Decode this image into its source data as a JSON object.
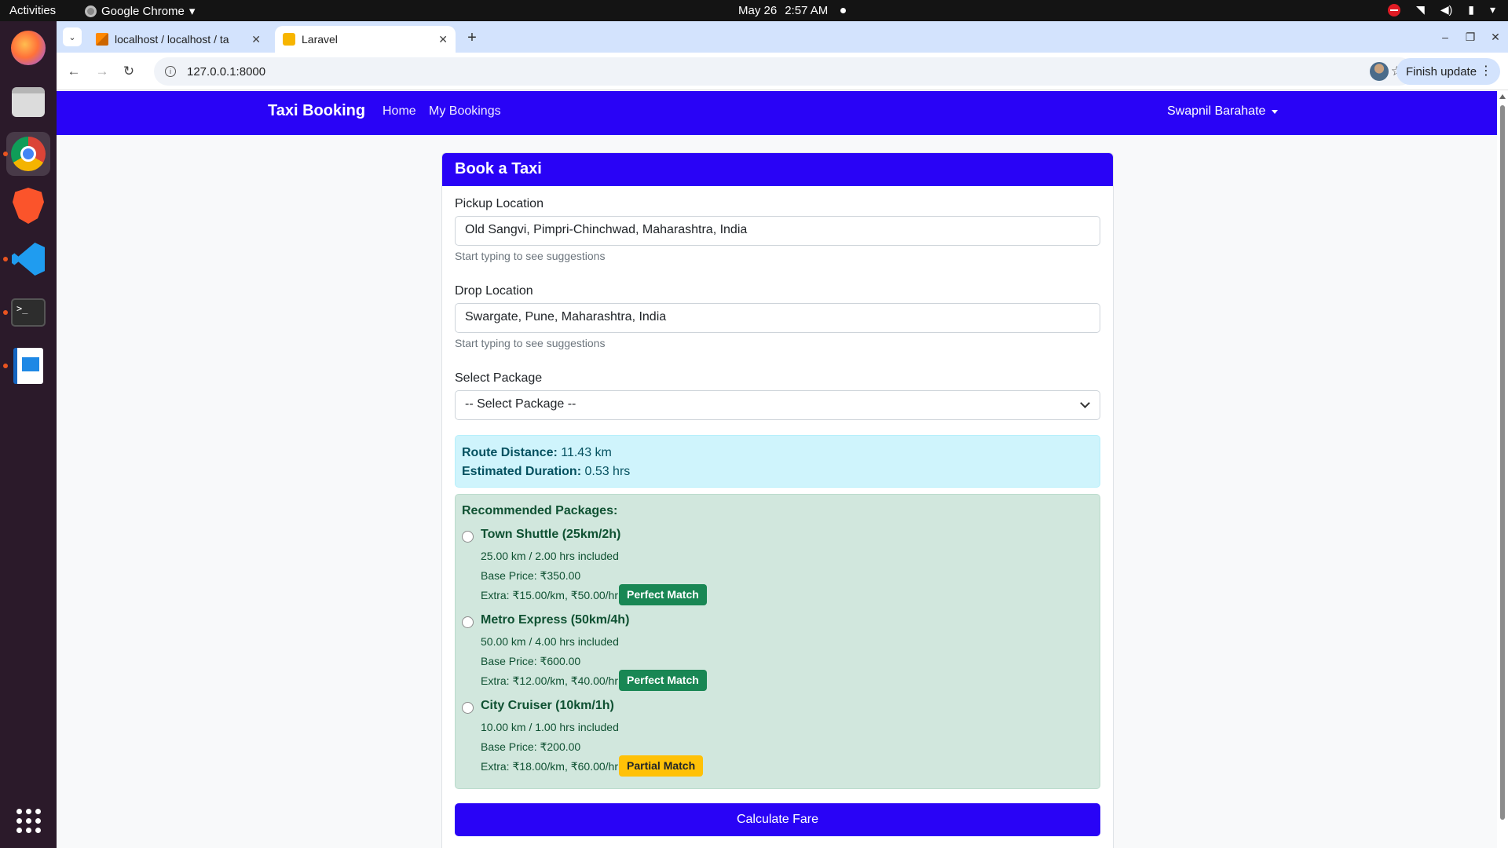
{
  "os": {
    "activities": "Activities",
    "app_name": "Google Chrome",
    "clock_date": "May 26",
    "clock_time": "2:57 AM"
  },
  "browser": {
    "tabs": [
      {
        "title": "localhost / localhost / ta"
      },
      {
        "title": "Laravel"
      }
    ],
    "url": "127.0.0.1:8000",
    "finish_update": "Finish update"
  },
  "navbar": {
    "brand": "Taxi Booking",
    "links": [
      "Home",
      "My Bookings"
    ],
    "user": "Swapnil Barahate"
  },
  "card": {
    "title": "Book a Taxi",
    "pickup": {
      "label": "Pickup Location",
      "value": "Old Sangvi, Pimpri-Chinchwad, Maharashtra, India",
      "help": "Start typing to see suggestions"
    },
    "drop": {
      "label": "Drop Location",
      "value": "Swargate, Pune, Maharashtra, India",
      "help": "Start typing to see suggestions"
    },
    "package": {
      "label": "Select Package",
      "selected": "-- Select Package --"
    },
    "route": {
      "distance_label": "Route Distance:",
      "distance_value": "11.43 km",
      "duration_label": "Estimated Duration:",
      "duration_value": "0.53 hrs"
    },
    "recommended": {
      "title": "Recommended Packages:",
      "packages": [
        {
          "name": "Town Shuttle (25km/2h)",
          "included": "25.00 km / 2.00 hrs included",
          "base": "Base Price: ₹350.00",
          "extra": "Extra: ₹15.00/km, ₹50.00/hr",
          "badge": "Perfect Match"
        },
        {
          "name": "Metro Express (50km/4h)",
          "included": "50.00 km / 4.00 hrs included",
          "base": "Base Price: ₹600.00",
          "extra": "Extra: ₹12.00/km, ₹40.00/hr",
          "badge": "Perfect Match"
        },
        {
          "name": "City Cruiser (10km/1h)",
          "included": "10.00 km / 1.00 hrs included",
          "base": "Base Price: ₹200.00",
          "extra": "Extra: ₹18.00/km, ₹60.00/hr",
          "badge": "Partial Match"
        }
      ]
    },
    "button": "Calculate Fare"
  },
  "colors": {
    "primary": "#2903f6",
    "success": "#198754",
    "warning": "#ffc107",
    "info_bg": "#cff4fc",
    "success_bg": "#d1e7dd"
  }
}
